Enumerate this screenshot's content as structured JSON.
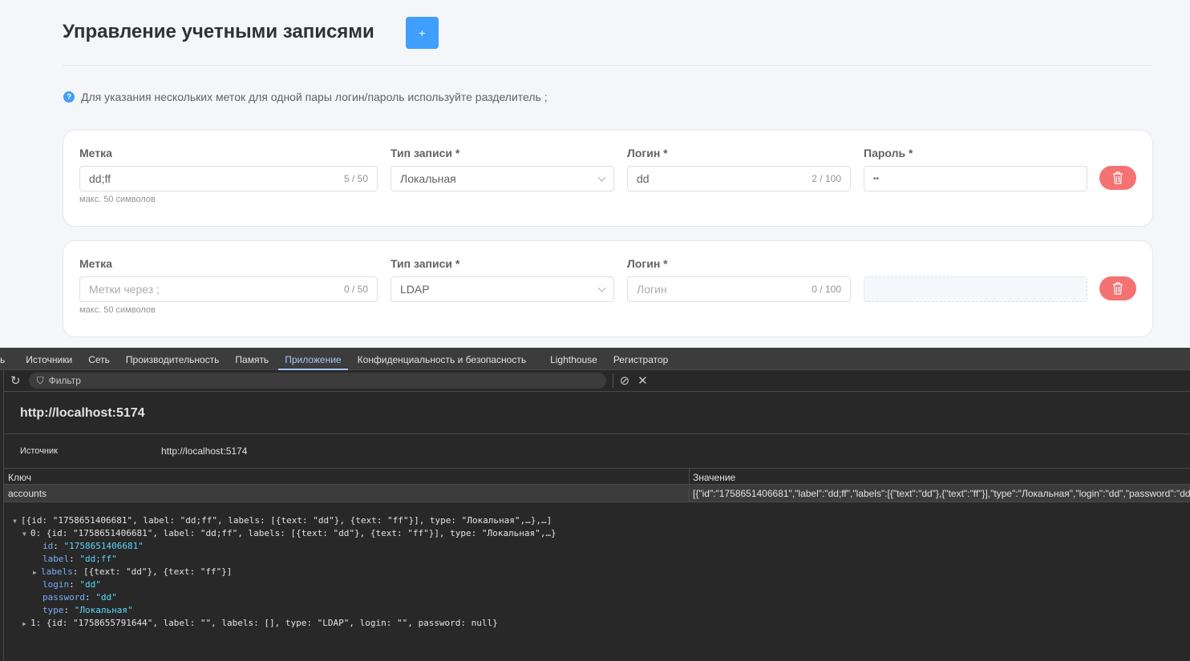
{
  "header": {
    "title": "Управление учетными записями",
    "add_label": "+"
  },
  "info": "Для указания нескольких меток для одной пары логин/пароль используйте разделитель ;",
  "labels": {
    "tag": "Метка",
    "type": "Тип записи *",
    "login": "Логин *",
    "password": "Пароль *",
    "hint": "макс. 50 символов"
  },
  "accounts": [
    {
      "tag": "dd;ff",
      "tag_count": "5 / 50",
      "type": "Локальная",
      "login": "dd",
      "login_count": "2 / 100",
      "password": "••"
    },
    {
      "tag_placeholder": "Метки через ;",
      "tag_count": "0 / 50",
      "type": "LDAP",
      "login_placeholder": "Логин",
      "login_count": "0 / 100"
    }
  ],
  "devtools": {
    "tabs": [
      "ь",
      "Источники",
      "Сеть",
      "Производительность",
      "Память",
      "Приложение",
      "Конфиденциальность и безопасность",
      "Lighthouse",
      "Регистратор"
    ],
    "filter_placeholder": "Фильтр",
    "origin_title": "http://localhost:5174",
    "source_label": "Источник",
    "source_value": "http://localhost:5174",
    "col_key": "Ключ",
    "col_value": "Значение",
    "row_key": "accounts",
    "row_value": "[{\"id\":\"1758651406681\",\"label\":\"dd;ff\",\"labels\":[{\"text\":\"dd\"},{\"text\":\"ff\"}],\"type\":\"Локальная\",\"login\":\"dd\",\"password\":\"dd\"",
    "tree": {
      "root": "[{id: \"1758651406681\", label: \"dd;ff\", labels: [{text: \"dd\"}, {text: \"ff\"}], type: \"Локальная\",…},…]",
      "item0": "0: {id: \"1758651406681\", label: \"dd;ff\", labels: [{text: \"dd\"}, {text: \"ff\"}], type: \"Локальная\",…}",
      "props": [
        {
          "k": "id",
          "v": "\"1758651406681\""
        },
        {
          "k": "label",
          "v": "\"dd;ff\""
        },
        {
          "k": "labels",
          "v": "[{text: \"dd\"}, {text: \"ff\"}]"
        },
        {
          "k": "login",
          "v": "\"dd\""
        },
        {
          "k": "password",
          "v": "\"dd\""
        },
        {
          "k": "type",
          "v": "\"Локальная\""
        }
      ],
      "item1": "1: {id: \"1758655791644\", label: \"\", labels: [], type: \"LDAP\", login: \"\", password: null}"
    }
  }
}
